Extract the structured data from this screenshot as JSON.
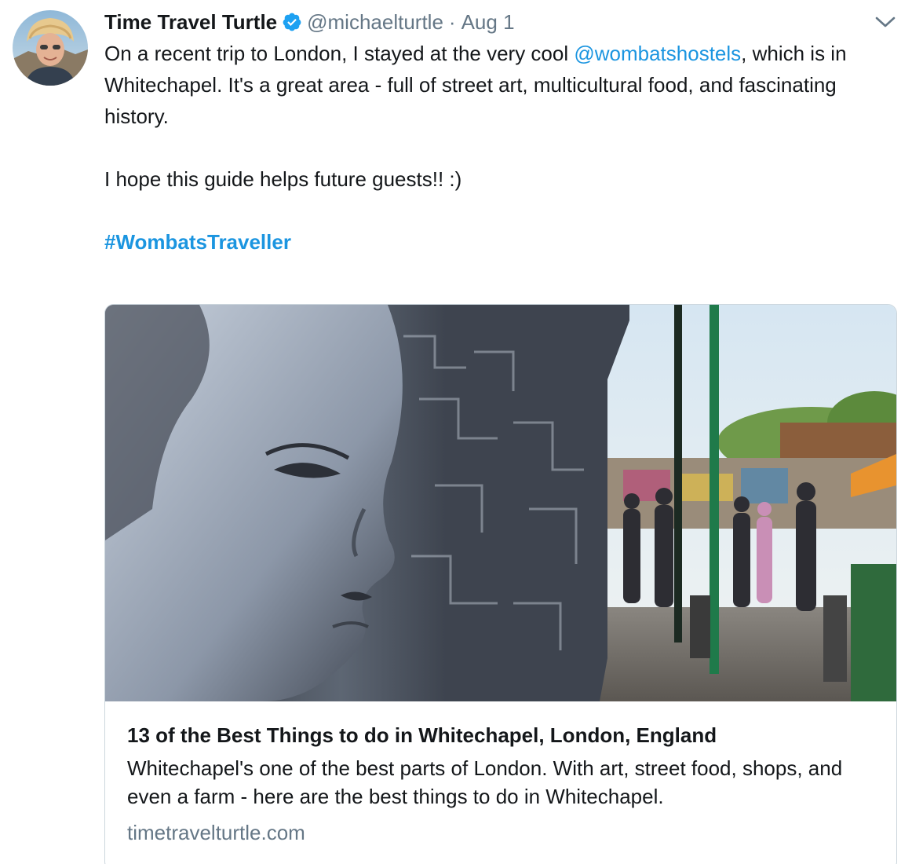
{
  "tweet": {
    "author": {
      "display_name": "Time Travel Turtle",
      "handle": "@michaelturtle",
      "verified": true
    },
    "separator": "·",
    "date": "Aug 1",
    "body": {
      "line1_before": "On a recent trip to London, I stayed at the very cool ",
      "mention": "@wombatshostels",
      "line1_after": ", which is in Whitechapel. It's a great area - full of street art, multicultural food, and fascinating history.",
      "paragraph2": "I hope this guide helps future guests!! :)",
      "hashtag": "#WombatsTraveller"
    },
    "card": {
      "title": "13 of the Best Things to do in Whitechapel, London, England",
      "description": "Whitechapel's one of the best parts of London. With art, street food, shops, and even a farm - here are the best things to do in Whitechapel.",
      "domain": "timetravelturtle.com",
      "image_icon": "street-art-mural-photo"
    },
    "icons": {
      "verified": "verified-badge-icon",
      "menu": "chevron-down-icon"
    },
    "colors": {
      "link": "#1b95e0",
      "secondary_text": "#657786",
      "primary_text": "#14171a",
      "verified": "#1da1f2",
      "card_border": "#ccd6dd"
    }
  }
}
